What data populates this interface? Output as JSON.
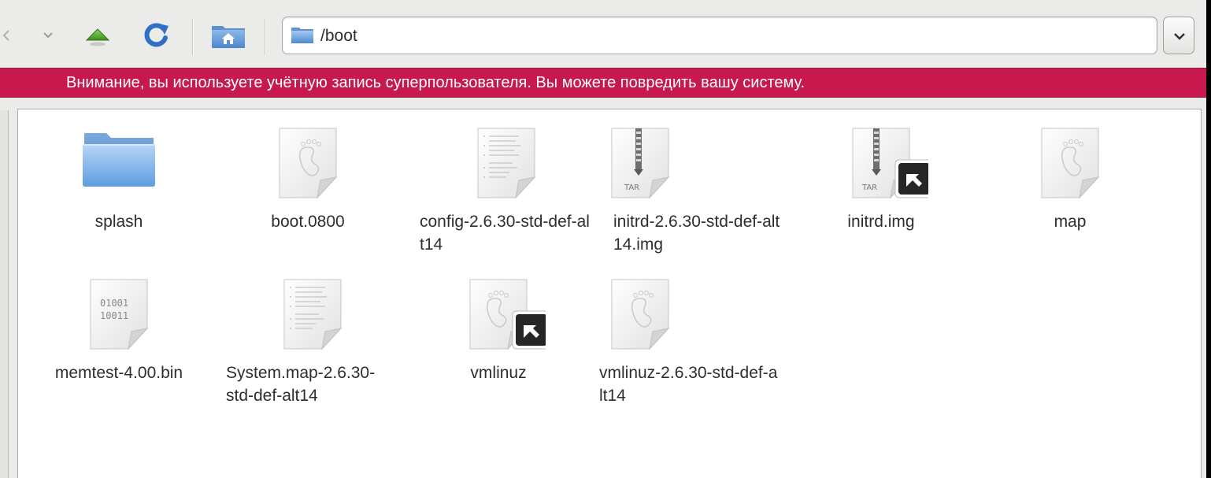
{
  "toolbar": {
    "back_icon": "back-arrow-icon",
    "history_icon": "chevron-down-icon",
    "up_icon": "up-arrow-icon",
    "reload_icon": "reload-icon",
    "home_icon": "home-folder-icon"
  },
  "location": {
    "path": "/boot",
    "icon": "folder-icon"
  },
  "warning": {
    "text": "Внимание, вы используете учётную запись суперпользователя. Вы можете повредить вашу систему.",
    "color": "#c7194e"
  },
  "files": [
    {
      "name": "splash",
      "icon": "folder-icon"
    },
    {
      "name": "boot.0800",
      "icon": "generic-file-icon"
    },
    {
      "name": "config-2.6.30-std-def-alt14",
      "icon": "text-document-icon"
    },
    {
      "name": "initrd-2.6.30-std-def-alt14.img",
      "icon": "tar-archive-icon"
    },
    {
      "name": "initrd.img",
      "icon": "tar-archive-symlink-icon"
    },
    {
      "name": "map",
      "icon": "generic-file-icon"
    },
    {
      "name": "memtest-4.00.bin",
      "icon": "binary-file-icon"
    },
    {
      "name": "System.map-2.6.30-std-def-alt14",
      "icon": "text-document-icon"
    },
    {
      "name": "vmlinuz",
      "icon": "generic-file-symlink-icon"
    },
    {
      "name": "vmlinuz-2.6.30-std-def-alt14",
      "icon": "generic-file-icon"
    }
  ]
}
